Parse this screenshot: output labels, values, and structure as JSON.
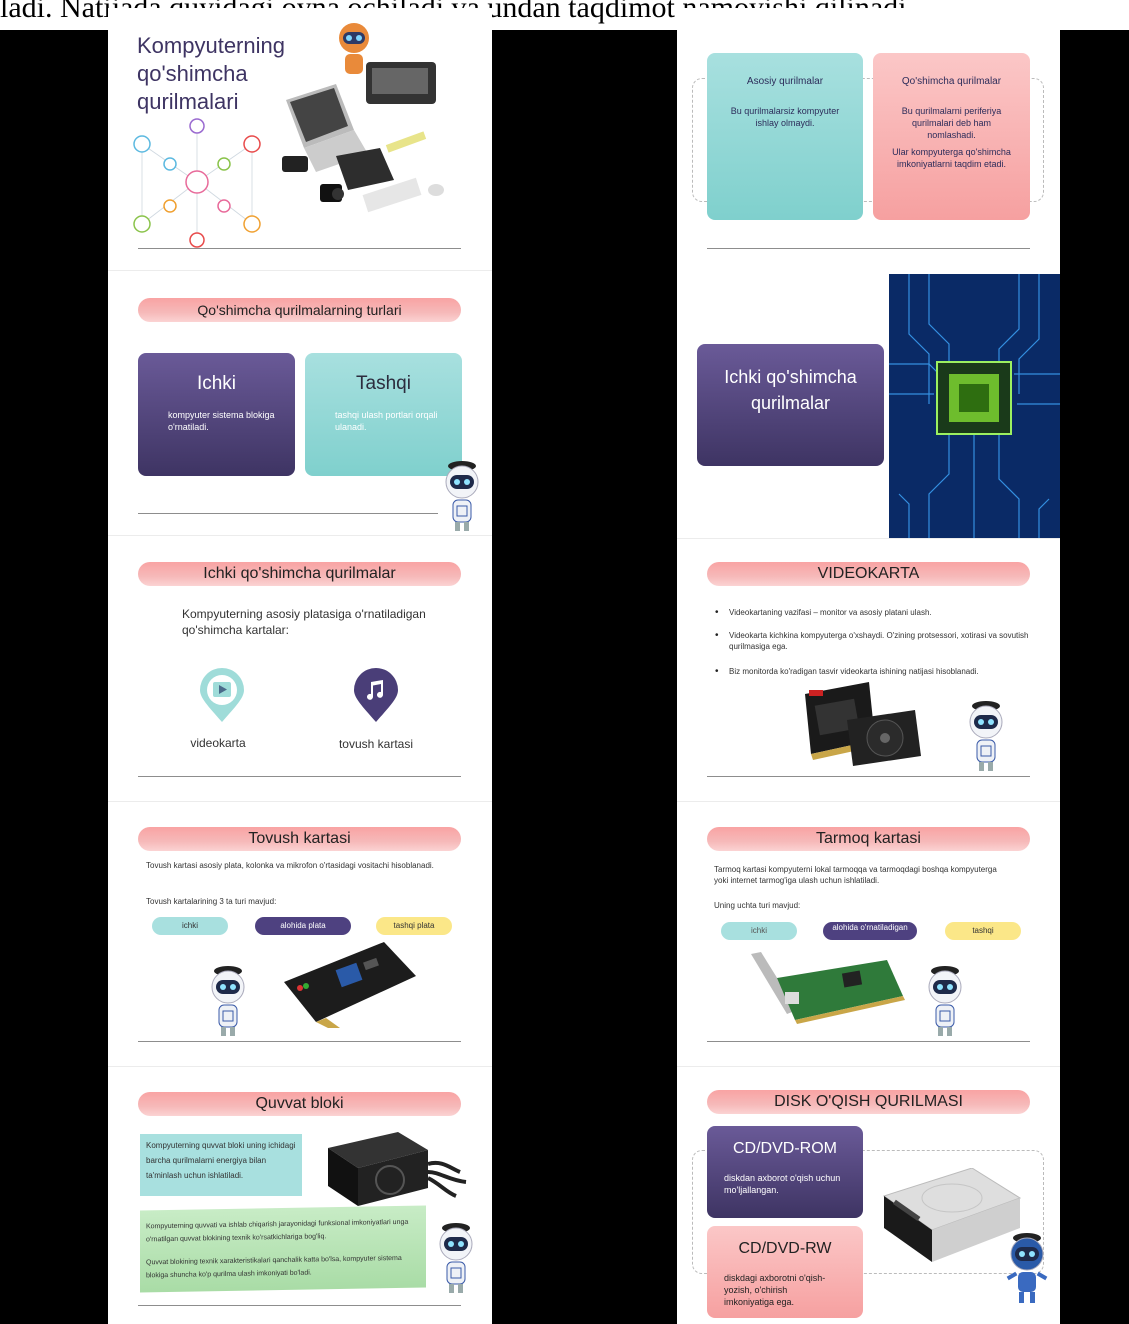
{
  "top_text": "ladi. Natijada quyidagi oyna ochiladi va undan taqdimot namoyishi qilinadi.",
  "left": {
    "s1_title": "Kompyuterning qo'shimcha qurilmalari",
    "s2_pill": "Qo'shimcha qurilmalarning turlari",
    "ichki_title": "Ichki",
    "ichki_text": "kompyuter sistema blokiga o'rnatiladi.",
    "tashqi_title": "Tashqi",
    "tashqi_text": "tashqi ulash portlari orqali ulanadi.",
    "s3_pill": "Ichki qo'shimcha qurilmalar",
    "s3_text": "Kompyuterning asosiy platasiga o'rnatiladigan qo'shimcha kartalar:",
    "icon1_label": "videokarta",
    "icon2_label": "tovush kartasi",
    "s4_pill": "Tovush kartasi",
    "s4_text1": "Tovush kartasi asosiy plata, kolonka va mikrofon o'rtasidagi vositachi hisoblanadi.",
    "s4_text2": "Tovush kartalarining 3 ta turi mavjud:",
    "s4_chips": [
      "ichki",
      "alohida plata",
      "tashqi plata"
    ],
    "s5_pill": "Quvvat bloki",
    "s5_box1": "Kompyuterning quvvat bloki uning ichidagi barcha qurilmalarni energiya bilan ta'minlash uchun ishlatiladi.",
    "s5_box2a": "Kompyuterning quvvati va ishlab chiqarish jarayonidagi funksional imkoniyatlari unga o'rnatilgan quvvat blokining texnik ko'rsatkichlariga bog'liq.",
    "s5_box2b": "Quvvat blokining texnik xarakteristikalari qanchalik katta bo'lsa, kompyuter sistema blokiga shuncha ko'p qurilma ulash imkoniyati bo'ladi."
  },
  "right": {
    "asosiy_title": "Asosiy qurilmalar",
    "asosiy_text": "Bu qurilmalarsiz kompyuter ishlay olmaydi.",
    "qosh_title": "Qo'shimcha qurilmalar",
    "qosh_text1": "Bu qurilmalarni periferiya qurilmalari deb ham nomlashadi.",
    "qosh_text2": "Ular kompyuterga qo'shimcha imkoniyatlarni taqdim etadi.",
    "s2_box": "Ichki qo'shimcha qurilmalar",
    "s3_pill": "VIDEOKARTA",
    "s3_bullets": [
      "Videokartaning vazifasi – monitor va asosiy platani ulash.",
      "Videokarta kichkina kompyuterga o'xshaydi. O'zining protsessori, xotirasi va sovutish qurilmasiga ega.",
      "Biz monitorda ko'radigan tasvir videokarta ishining natijasi hisoblanadi."
    ],
    "s4_pill": "Tarmoq kartasi",
    "s4_text1": "Tarmoq kartasi kompyuterni lokal tarmoqqa va tarmoqdagi boshqa kompyuterga yoki internet tarmog'iga ulash uchun ishlatiladi.",
    "s4_text2": "Uning uchta turi mavjud:",
    "s4_chips": [
      "ichki",
      "alohida o'rnatiladigan",
      "tashqi"
    ],
    "s5_pill": "DISK O'QISH QURILMASI",
    "rom_title": "CD/DVD-ROM",
    "rom_text": "diskdan axborot o'qish uchun mo'ljallangan.",
    "rw_title": "CD/DVD-RW",
    "rw_text": "diskdagi axborotni o'qish-yozish, o'chirish imkoniyatiga ega."
  }
}
